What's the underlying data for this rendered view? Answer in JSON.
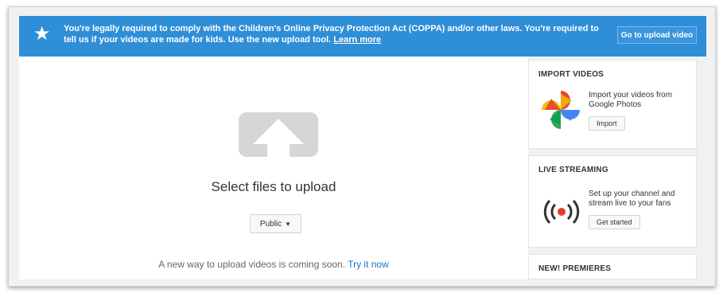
{
  "banner": {
    "star_glyph": "★",
    "message": "You're legally required to comply with the Children's Online Privacy Protection Act (COPPA) and/or other laws. You're required to tell us if your videos are made for kids. Use the new upload tool.",
    "learn_more": "Learn more",
    "button_label": "Go to upload video",
    "color": "#2f8ed8"
  },
  "upload": {
    "title": "Select files to upload",
    "privacy_value": "Public",
    "new_way_text": "A new way to upload videos is coming soon.",
    "try_link": "Try it now",
    "icon": "upload-arrow-icon"
  },
  "sidebar": {
    "import": {
      "title": "IMPORT VIDEOS",
      "description": "Import your videos from Google Photos",
      "button": "Import",
      "icon": "google-photos-icon"
    },
    "live": {
      "title": "LIVE STREAMING",
      "description": "Set up your channel and stream live to your fans",
      "button": "Get started",
      "icon": "live-broadcast-icon"
    },
    "premieres": {
      "title": "NEW! PREMIERES"
    }
  }
}
